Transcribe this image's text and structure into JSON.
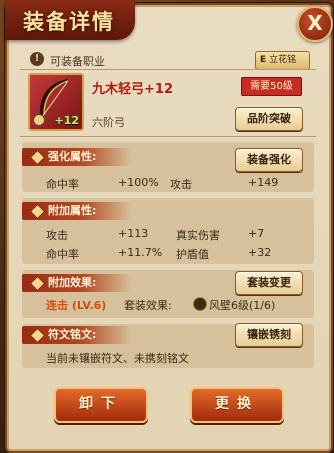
{
  "title": "装备详情",
  "close_label": "X",
  "header": {
    "equip_class_label": "可装备职业",
    "class_grade": "E",
    "class_name": "立花铭"
  },
  "item": {
    "name": "九木轻弓+12",
    "level_requirement": "需要50级",
    "plus": "+12",
    "tier": "六阶弓",
    "tier_button": "品阶突破"
  },
  "strengthen": {
    "label": "强化属性:",
    "button": "装备强化",
    "stats": [
      {
        "name": "命中率",
        "value": "+100%"
      },
      {
        "name": "攻击",
        "value": "+149"
      }
    ]
  },
  "additional": {
    "label": "附加属性:",
    "stats": [
      {
        "name": "攻击",
        "value": "+113"
      },
      {
        "name": "真实伤害",
        "value": "+7"
      },
      {
        "name": "命中率",
        "value": "+11.7%"
      },
      {
        "name": "护盾值",
        "value": "+32"
      }
    ]
  },
  "effects": {
    "label": "附加效果:",
    "button": "套装变更",
    "effect_name": "连击",
    "effect_level": "(LV.6)",
    "set_label": "套装效果:",
    "set_name": "风壁6级(1/6)"
  },
  "runes": {
    "label": "符文铭文:",
    "button": "镶嵌锈刻",
    "description": "当前未镶嵌符文、未携刻铭文"
  },
  "actions": {
    "unequip": "卸下",
    "replace": "更换"
  },
  "colors": {
    "accent_red": "#b01c0c",
    "section_bar": "#9a2a14",
    "panel_bg": "#e9dcc0",
    "bonus_green": "#a8ff6a",
    "effect_orange": "#d4500a"
  }
}
